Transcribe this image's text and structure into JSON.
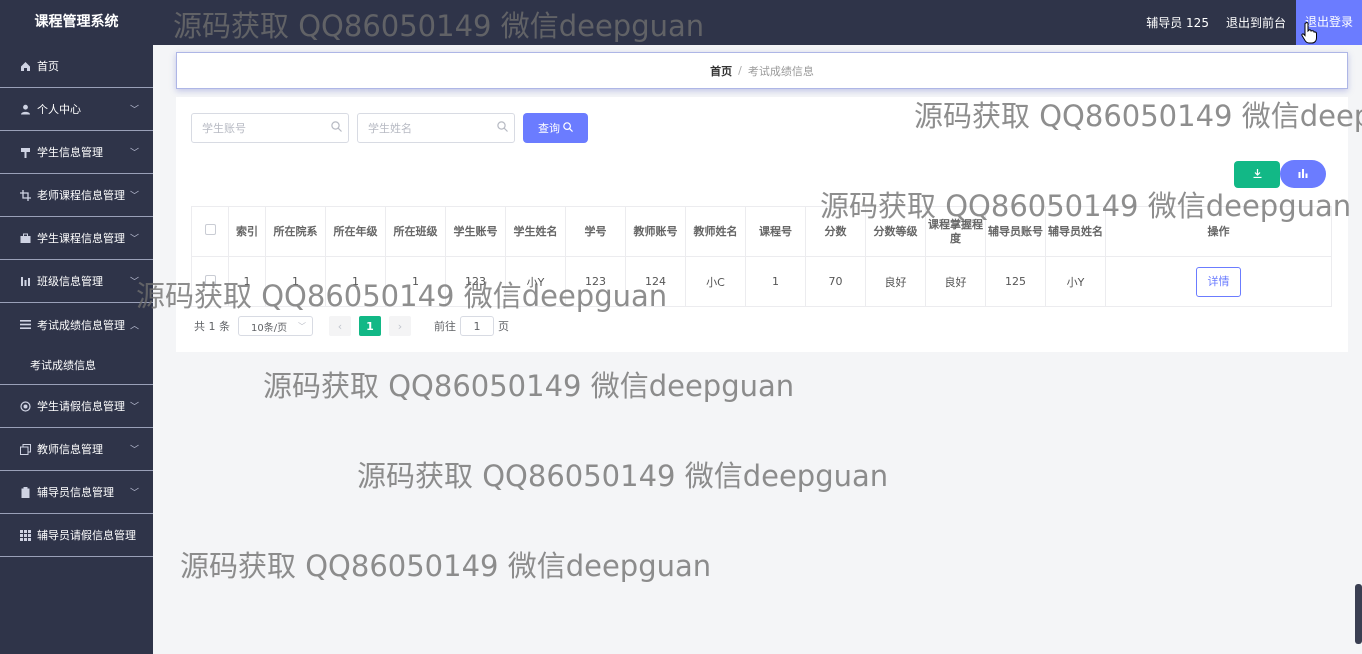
{
  "app": {
    "title": "课程管理系统"
  },
  "header": {
    "user_label": "辅导员 125",
    "front_link": "退出到前台",
    "logout": "退出登录"
  },
  "sidebar": {
    "items": [
      {
        "label": "首页",
        "icon": "home-icon"
      },
      {
        "label": "个人中心",
        "icon": "user-icon"
      },
      {
        "label": "学生信息管理",
        "icon": "hammer-icon"
      },
      {
        "label": "老师课程信息管理",
        "icon": "crop-icon"
      },
      {
        "label": "学生课程信息管理",
        "icon": "briefcase-icon"
      },
      {
        "label": "班级信息管理",
        "icon": "bar-chart-icon"
      },
      {
        "label": "考试成绩信息管理",
        "icon": "list-icon"
      },
      {
        "label": "学生请假信息管理",
        "icon": "circle-icon"
      },
      {
        "label": "教师信息管理",
        "icon": "copy-icon"
      },
      {
        "label": "辅导员信息管理",
        "icon": "clipboard-icon"
      },
      {
        "label": "辅导员请假信息管理",
        "icon": "grid-icon"
      }
    ],
    "submenu": {
      "label": "考试成绩信息"
    }
  },
  "breadcrumb": {
    "home": "首页",
    "separator": "/",
    "current": "考试成绩信息"
  },
  "search": {
    "account_placeholder": "学生账号",
    "name_placeholder": "学生姓名",
    "query_label": "查询"
  },
  "table": {
    "headers": [
      "索引",
      "所在院系",
      "所在年级",
      "所在班级",
      "学生账号",
      "学生姓名",
      "学号",
      "教师账号",
      "教师姓名",
      "课程号",
      "分数",
      "分数等级",
      "课程掌握程度",
      "辅导员账号",
      "辅导员姓名",
      "操作"
    ],
    "rows": [
      [
        "1",
        "1",
        "1",
        "1",
        "123",
        "小Y",
        "123",
        "124",
        "小C",
        "1",
        "70",
        "良好",
        "良好",
        "125",
        "小Y"
      ]
    ],
    "detail_label": "详情"
  },
  "pagination": {
    "total": "共 1 条",
    "page_size": "10条/页",
    "current_page": "1",
    "goto_label": "前往",
    "goto_value": "1",
    "page_suffix": "页"
  },
  "watermark": "源码获取 QQ86050149 微信deepguan",
  "colors": {
    "sidebar_bg": "#2f3449",
    "accent": "#6b7cff",
    "success": "#12b886"
  }
}
